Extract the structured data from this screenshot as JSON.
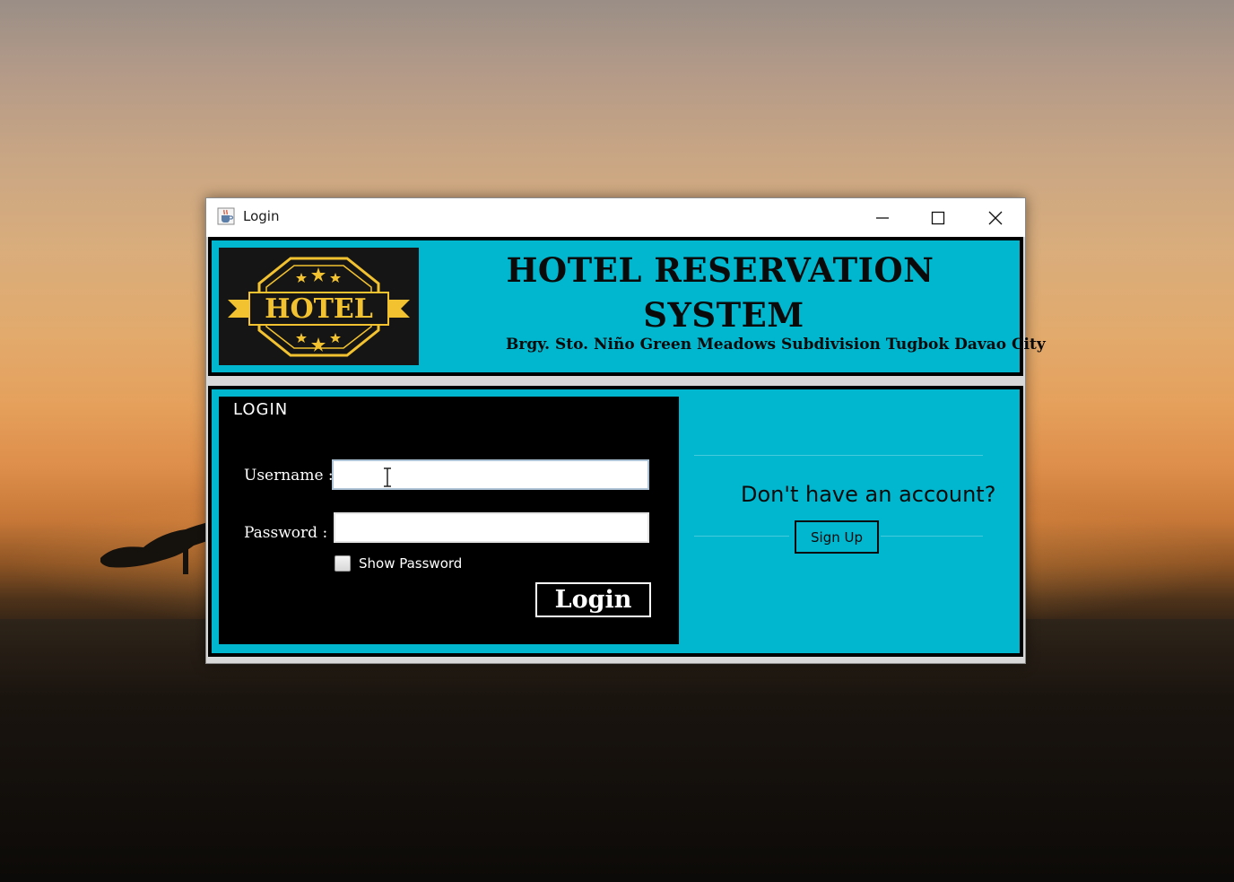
{
  "window": {
    "title": "Login",
    "minimize_label": "",
    "maximize_label": "",
    "close_label": ""
  },
  "header": {
    "logo_text": "HOTEL",
    "title_line1": "HOTEL RESERVATION",
    "title_line2": "SYSTEM",
    "address": "Brgy. Sto. Niño Green Meadows Subdivision Tugbok Davao City"
  },
  "login": {
    "heading": "LOGIN",
    "username_label": "Username :",
    "username_value": "",
    "password_label": "Password :",
    "password_value": "",
    "show_password_label": "Show Password",
    "show_password_checked": false,
    "login_button": "Login"
  },
  "signup": {
    "prompt": "Don't have an account?",
    "button": "Sign Up"
  },
  "colors": {
    "panel_bg": "#00b7cf",
    "login_bg": "#000000",
    "logo_gold": "#f2c230",
    "logo_bg": "#151515"
  },
  "icons": {
    "app": "java-cup-icon",
    "minimize": "minimize-icon",
    "maximize": "maximize-icon",
    "close": "close-icon",
    "cursor": "text-cursor-icon"
  }
}
